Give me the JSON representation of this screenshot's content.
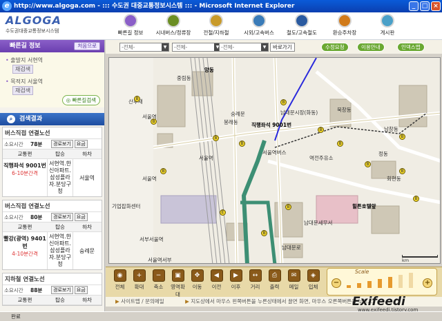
{
  "window": {
    "title": "http://www.algoga.com - ::: 수도권 대중교통정보시스템 ::: - Microsoft Internet Explorer"
  },
  "logo": {
    "name": "ALGOGA",
    "subtitle": "수도권대중교통정보시스템"
  },
  "nav": [
    {
      "label": "빠른길 정보",
      "color": "#8b5fc8",
      "icon": "quick-route-icon"
    },
    {
      "label": "시내버스/정류장",
      "color": "#6b8e23",
      "icon": "city-bus-icon"
    },
    {
      "label": "전철/지하철",
      "color": "#c89a2a",
      "icon": "subway-icon"
    },
    {
      "label": "시외/고속버스",
      "color": "#3a7bb8",
      "icon": "express-bus-icon"
    },
    {
      "label": "철도/고속철도",
      "color": "#2a5aa0",
      "icon": "rail-icon"
    },
    {
      "label": "환승주차장",
      "color": "#d07a1a",
      "icon": "parking-icon"
    },
    {
      "label": "게시판",
      "color": "#4aa0c8",
      "icon": "board-icon"
    }
  ],
  "left_panel": {
    "quick_title": "빠른길 정보",
    "reset_label": "처음으로",
    "origin_label": "출발지 서현역",
    "origin_btn": "재검색",
    "dest_label": "목적지 서울역",
    "dest_btn": "재검색",
    "search_btn": "빠른길검색",
    "result_title": "검색결과",
    "cards": [
      {
        "title": "버스직접 연결노선",
        "time_label": "소요시간",
        "time": "78분",
        "route_btn": "경로보기",
        "fare_btn": "요금",
        "cols": [
          "교통편",
          "탑승",
          "하차"
        ],
        "route": "직행좌석 9001번",
        "interval": "6-10분간격",
        "board": "서현역.한신아파트.삼성플라자.분당구청",
        "alight": "서울역"
      },
      {
        "title": "버스직접 연결노선",
        "time_label": "소요시간",
        "time": "80분",
        "route_btn": "경로보기",
        "fare_btn": "요금",
        "cols": [
          "교통편",
          "탑승",
          "하차"
        ],
        "route": "빨강(광역) 9401번",
        "interval": "4-10분간격",
        "board": "서현역.한신아파트.삼성플라자.분당구청",
        "alight": "숭례문"
      },
      {
        "title": "지하철 연결노선",
        "time_label": "소요시간",
        "time": "88분",
        "route_btn": "경로보기",
        "fare_btn": "요금",
        "cols": [
          "교통편",
          "탑승",
          "하차"
        ]
      }
    ]
  },
  "controls": {
    "select1": "-전체-",
    "select2": "-전체-",
    "select3": "-전체-",
    "go_btn": "바로가기",
    "pill1": "수정요청",
    "pill2": "이용안내",
    "pill3": "인덱스맵"
  },
  "map": {
    "labels": {
      "l_jungnim": "중림동",
      "l_seoulyeok1": "서울역",
      "l_seoulyeok2": "서울역",
      "l_seoulyeok3": "서울역",
      "l_sanhoe": "산후재",
      "l_seoulyeok_center": "서울역",
      "l_yeokjeon": "역전주유소",
      "l_gijeok": "기업잡화센터",
      "l_seoulyeok_bottom": "서부서울역",
      "l_seoulbu": "서울역서부",
      "l_namdaemun": "남대문로",
      "l_jikhaeng": "직행좌석 9001번",
      "l_seorae": "숭례문",
      "l_namdaemun_market": "남대문시장(화동)",
      "l_hilton": "힐튼호텔앞",
      "l_namdaemun_gwan": "남대문세무서",
      "l_hoehyeon": "회현동",
      "l_yangdong": "양동",
      "l_seoulbus": "서울역버스",
      "l_bongrae": "봉래동",
      "l_jeongdong": "정동",
      "l_namchang": "남창동",
      "l_bukchang": "북창동"
    },
    "scale_unit": "km"
  },
  "tools": [
    {
      "label": "전체",
      "icon": "full-view-icon",
      "glyph": "◉"
    },
    {
      "label": "확대",
      "icon": "zoom-in-icon",
      "glyph": "+"
    },
    {
      "label": "축소",
      "icon": "zoom-out-icon",
      "glyph": "−"
    },
    {
      "label": "영역확대",
      "icon": "area-zoom-icon",
      "glyph": "▣"
    },
    {
      "label": "이동",
      "icon": "pan-icon",
      "glyph": "✥"
    },
    {
      "label": "이전",
      "icon": "prev-icon",
      "glyph": "◀"
    },
    {
      "label": "이후",
      "icon": "next-icon",
      "glyph": "▶"
    },
    {
      "label": "거리",
      "icon": "distance-icon",
      "glyph": "↔"
    },
    {
      "label": "출력",
      "icon": "print-icon",
      "glyph": "⎙"
    },
    {
      "label": "메일",
      "icon": "mail-icon",
      "glyph": "✉"
    },
    {
      "label": "입체",
      "icon": "3d-icon",
      "glyph": "◈"
    }
  ],
  "scale_widget": {
    "title": "Scale",
    "level": 5,
    "levels": 7
  },
  "info": {
    "sitemap": "사이트맵 / 문의메일",
    "tip": "지도상에서 마우스 왼쪽버튼을 누른상태에서 끌면 화면, 마우스 오른쪽버튼을 누르..."
  },
  "status": {
    "text": "완료"
  },
  "watermark": {
    "brand": "Exifeedi",
    "url": "www.exifeedi.tistory.com"
  }
}
